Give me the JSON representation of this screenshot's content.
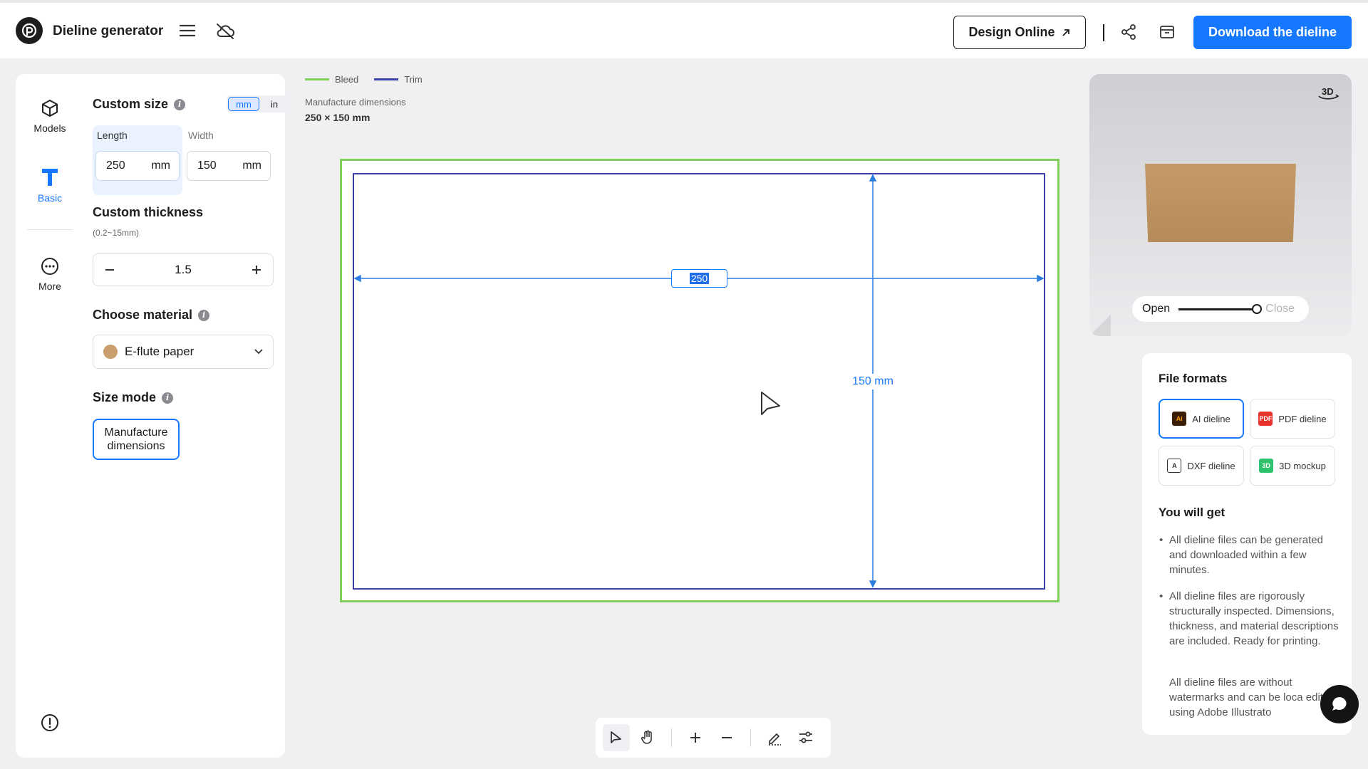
{
  "header": {
    "app_title": "Dieline generator",
    "design_online_label": "Design Online",
    "download_label": "Download the dieline"
  },
  "sidebar": {
    "items": [
      {
        "label": "Models",
        "icon": "cube-icon"
      },
      {
        "label": "Basic",
        "icon": "text-t-icon",
        "active": true
      },
      {
        "label": "More",
        "icon": "more-dots-icon"
      }
    ]
  },
  "settings": {
    "custom_size_title": "Custom size",
    "units": [
      "mm",
      "in"
    ],
    "active_unit": "mm",
    "length": {
      "label": "Length",
      "value": "250",
      "unit": "mm"
    },
    "width": {
      "label": "Width",
      "value": "150",
      "unit": "mm"
    },
    "thickness_title": "Custom thickness",
    "thickness_range": "(0.2~15mm)",
    "thickness_value": "1.5",
    "material_title": "Choose material",
    "material_value": "E-flute paper",
    "size_mode_title": "Size mode",
    "size_mode_value": "Manufacture dimensions"
  },
  "canvas": {
    "legend": [
      {
        "label": "Bleed",
        "color": "#7fcf5b"
      },
      {
        "label": "Trim",
        "color": "#3b3fa8"
      }
    ],
    "manufacture_title": "Manufacture dimensions",
    "manufacture_size": "250 × 150 mm",
    "length_label": "250",
    "width_label": "150 mm"
  },
  "preview": {
    "badge": "3D",
    "open_label": "Open",
    "close_label": "Close",
    "open_level": 1.0
  },
  "formats": {
    "title": "File formats",
    "options": [
      {
        "label": "AI dieline",
        "icon": "ai-file-icon",
        "active": true
      },
      {
        "label": "PDF dieline",
        "icon": "pdf-file-icon"
      },
      {
        "label": "DXF dieline",
        "icon": "dxf-file-icon"
      },
      {
        "label": "3D mockup",
        "icon": "mockup-icon"
      }
    ],
    "you_will_get_title": "You will get",
    "bullets": [
      "All dieline files can be generated and downloaded within a few minutes.",
      "All dieline files are rigorously structurally inspected. Dimensions, thickness, and material descriptions are included. Ready for printing.",
      "All dieline files are without watermarks and can be loca edited using Adobe Illustrato"
    ]
  },
  "colors": {
    "accent": "#1677ff",
    "bleed": "#7fcf5b",
    "trim": "#3b3fa8"
  }
}
